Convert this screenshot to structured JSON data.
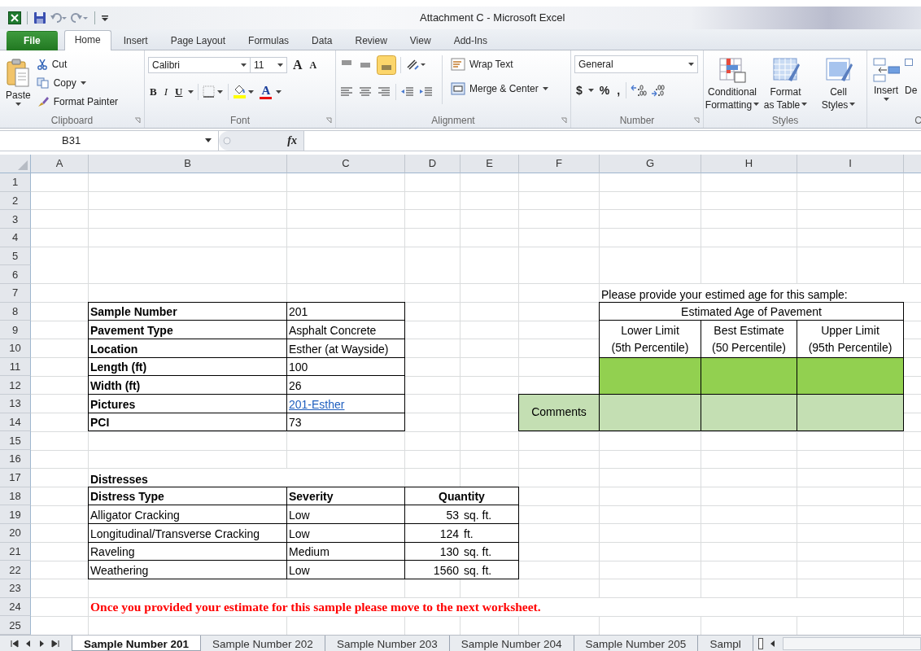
{
  "window": {
    "title": "Attachment C  -  Microsoft Excel"
  },
  "menu_tabs": [
    {
      "label": "File",
      "kind": "file",
      "selected": false
    },
    {
      "label": "Home",
      "kind": "tab",
      "selected": true
    },
    {
      "label": "Insert",
      "kind": "tab",
      "selected": false
    },
    {
      "label": "Page Layout",
      "kind": "tab",
      "selected": false
    },
    {
      "label": "Formulas",
      "kind": "tab",
      "selected": false
    },
    {
      "label": "Data",
      "kind": "tab",
      "selected": false
    },
    {
      "label": "Review",
      "kind": "tab",
      "selected": false
    },
    {
      "label": "View",
      "kind": "tab",
      "selected": false
    },
    {
      "label": "Add-Ins",
      "kind": "tab",
      "selected": false
    }
  ],
  "ribbon": {
    "clipboard": {
      "title": "Clipboard",
      "paste": "Paste",
      "cut": "Cut",
      "copy": "Copy",
      "format_painter": "Format Painter"
    },
    "font": {
      "title": "Font",
      "family": "Calibri",
      "size": "11",
      "grow": "A",
      "shrink": "A",
      "bold": "B",
      "italic": "I",
      "underline": "U",
      "font_color": "A"
    },
    "alignment": {
      "title": "Alignment",
      "wrap_text": "Wrap Text",
      "merge": "Merge & Center"
    },
    "number": {
      "title": "Number",
      "format": "General",
      "currency": "$",
      "percent": "%",
      "comma": ","
    },
    "styles": {
      "title": "Styles",
      "buttons": [
        {
          "lines": [
            "Conditional",
            "Formatting"
          ],
          "kind": "conditional"
        },
        {
          "lines": [
            "Format",
            "as Table"
          ],
          "kind": "table"
        },
        {
          "lines": [
            "Cell",
            "Styles"
          ],
          "kind": "cell"
        }
      ]
    },
    "cells": {
      "title": "C",
      "insert": "Insert",
      "delete": "De"
    }
  },
  "formula_bar": {
    "name_box": "B31",
    "fx": "fx"
  },
  "columns": [
    "A",
    "B",
    "C",
    "D",
    "E",
    "F",
    "G",
    "H",
    "I"
  ],
  "row_numbers": [
    "1",
    "2",
    "3",
    "4",
    "5",
    "6",
    "7",
    "8",
    "9",
    "10",
    "11",
    "12",
    "13",
    "14",
    "15",
    "16",
    "17",
    "18",
    "19",
    "20",
    "21",
    "22",
    "23",
    "24",
    "25"
  ],
  "sample_table": [
    {
      "label": "Sample Number",
      "value": "201",
      "kind": "text"
    },
    {
      "label": "Pavement Type",
      "value": "Asphalt Concrete",
      "kind": "text"
    },
    {
      "label": "Location",
      "value": "Esther (at Wayside)",
      "kind": "text"
    },
    {
      "label": "Length (ft)",
      "value": "100",
      "kind": "text"
    },
    {
      "label": "Width (ft)",
      "value": "26",
      "kind": "text"
    },
    {
      "label": "Pictures",
      "value": "201-Esther",
      "kind": "link"
    },
    {
      "label": "PCI",
      "value": "73",
      "kind": "text"
    }
  ],
  "estimate": {
    "prompt": "Please provide your estimed age for this sample:",
    "header": "Estimated Age of Pavement",
    "columns": [
      {
        "line1": "Lower Limit",
        "line2": "(5th Percentile)"
      },
      {
        "line1": "Best Estimate",
        "line2": "(50 Percentile)"
      },
      {
        "line1": "Upper Limit",
        "line2": "(95th Percentile)"
      }
    ],
    "comments_label": "Comments"
  },
  "distresses": {
    "title": "Distresses",
    "columns": [
      "Distress Type",
      "Severity",
      "Quantity"
    ],
    "rows": [
      {
        "type": "Alligator Cracking",
        "severity": "Low",
        "quantity": "53",
        "unit": "sq. ft."
      },
      {
        "type": "Longitudinal/Transverse Cracking",
        "severity": "Low",
        "quantity": "124",
        "unit": "ft."
      },
      {
        "type": "Raveling",
        "severity": "Medium",
        "quantity": "130",
        "unit": "sq. ft."
      },
      {
        "type": "Weathering",
        "severity": "Low",
        "quantity": "1560",
        "unit": "sq. ft."
      }
    ]
  },
  "note": "Once you provided your estimate for this sample please move to the next worksheet.",
  "sheet_tabs": [
    {
      "label": "Sample Number 201",
      "selected": true
    },
    {
      "label": "Sample Number 202",
      "selected": false
    },
    {
      "label": "Sample Number 203",
      "selected": false
    },
    {
      "label": "Sample Number 204",
      "selected": false
    },
    {
      "label": "Sample Number 205",
      "selected": false
    },
    {
      "label": "Sampl",
      "selected": false
    }
  ]
}
